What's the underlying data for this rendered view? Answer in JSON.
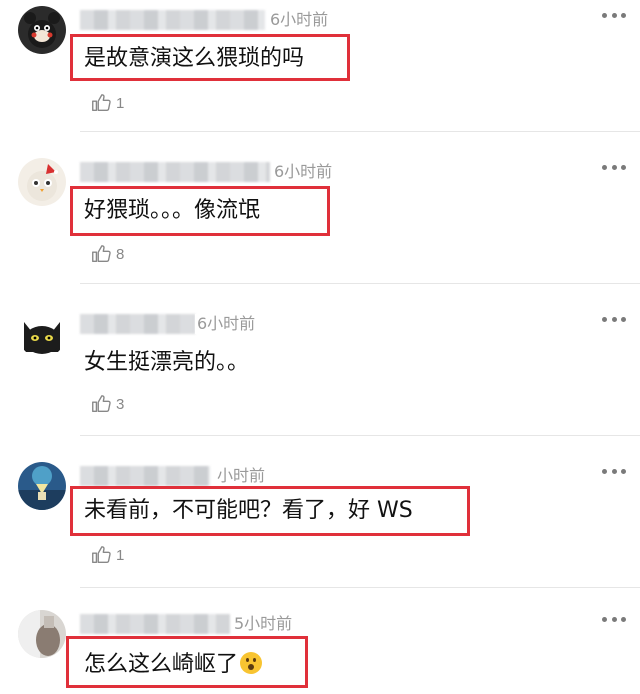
{
  "comments": [
    {
      "time": "6小时前",
      "text": "是故意演这么猥琐的吗",
      "likes": "1",
      "avatar_icon": "bear-avatar-icon"
    },
    {
      "time": "6小时前",
      "text": "好猥琐。。。像流氓",
      "likes": "8",
      "avatar_icon": "chick-avatar-icon"
    },
    {
      "time": "6小时前",
      "text": "女生挺漂亮的。。",
      "likes": "3",
      "avatar_icon": "cat-avatar-icon"
    },
    {
      "time": "小时前",
      "text": "未看前，不可能吧？看了，好 WS",
      "likes": "1",
      "avatar_icon": "scenery-avatar-icon"
    },
    {
      "time": "5小时前",
      "text": "怎么这么崎岖了",
      "likes": "",
      "avatar_icon": "photo-avatar-icon"
    }
  ],
  "colors": {
    "highlight": "#e0303a",
    "muted": "#9a9a9a",
    "divider": "#e6e6e6"
  },
  "icons": {
    "like": "thumbs-up-icon",
    "more": "more-dots-icon",
    "emoji": "surprised-emoji-icon"
  }
}
